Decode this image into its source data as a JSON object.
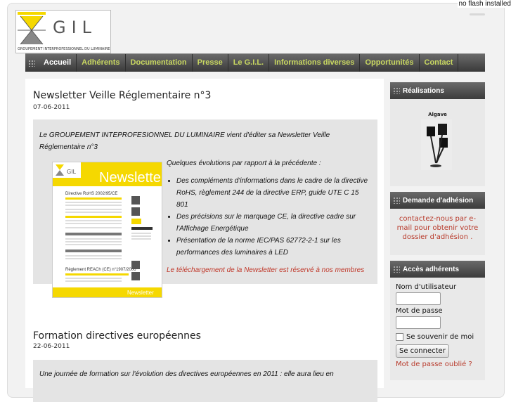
{
  "flash_notice": "no flash installed",
  "logo": {
    "text": "GIL",
    "subtitle": "GROUPEMENT INTERPROFESSIONNEL DU LUMINAIRE"
  },
  "nav": [
    {
      "label": "Accueil",
      "active": true
    },
    {
      "label": "Adhérents"
    },
    {
      "label": "Documentation"
    },
    {
      "label": "Presse"
    },
    {
      "label": "Le G.I.L."
    },
    {
      "label": "Informations diverses"
    },
    {
      "label": "Opportunités"
    },
    {
      "label": "Contact"
    }
  ],
  "posts": [
    {
      "title": "Newsletter Veille Réglementaire n°3",
      "date": "07-06-2011",
      "intro": "Le GROUPEMENT INTEPROFESIONNEL DU LUMINAIRE vient d'éditer sa Newsletter Veille Réglementaire n°3",
      "evolutions_heading": "Quelques évolutions par rapport à la précédente :",
      "bullets": [
        "Des compléments d'informations dans le cadre de la directive RoHS, règlement 244 de la directive ERP, guide UTE C 15 801",
        "Des précisions sur le marquage CE, la directive cadre sur l'Affichage Energétique",
        "Présentation de la norme IEC/PAS 62772-2-1 sur les performances des luminaires à LED"
      ],
      "download_note": "Le téléchargement de la Newsletter est réservé à nos membres"
    },
    {
      "title": "Formation directives européennes",
      "date": "22-06-2011",
      "intro": "Une journée de formation sur l'évolution des directives européennes en 2011 : elle aura lieu en"
    }
  ],
  "newsletter_image": {
    "logo": "GIL",
    "title": "Newsletter",
    "heading1": "Directive RoHS 2002/95/CE",
    "heading2": "Règlement REACh (CE) n°1907/2006",
    "footer": "Newsletter"
  },
  "sidebar": {
    "realisations": {
      "title": "Réalisations",
      "caption": "Algave"
    },
    "demande": {
      "title": "Demande d'adhésion",
      "text": "contactez-nous par e-mail pour obtenir votre dossier d'adhésion ."
    },
    "acces": {
      "title": "Accès adhérents",
      "username_label": "Nom d'utilisateur",
      "password_label": "Mot de passe",
      "remember_label": "Se souvenir de moi",
      "login_button": "Se connecter",
      "forgot_link": "Mot de passe oublié ?"
    }
  },
  "colors": {
    "nav_link": "#c9d860",
    "link_red": "#c0392b",
    "logo_yellow": "#f5d800"
  }
}
